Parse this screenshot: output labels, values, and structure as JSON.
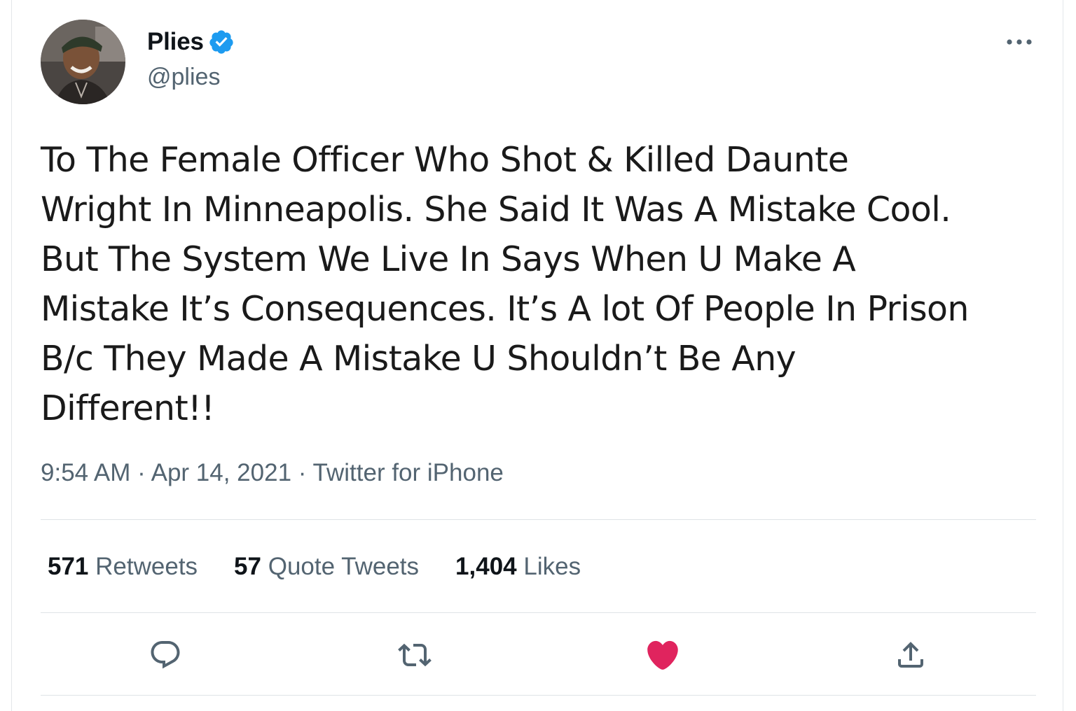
{
  "author": {
    "display_name": "Plies",
    "handle": "@plies",
    "verified_icon": "verified-badge-icon",
    "verified_color": "#1d9bf0"
  },
  "tweet": {
    "lines": [
      "To The Female Officer Who Shot & Killed Daunte",
      "Wright In Minneapolis. She Said It Was A Mistake Cool.",
      "But The System We Live In Says When U Make A",
      "Mistake It’s Consequences. It’s A lot Of People In Prison",
      "B/c They Made A Mistake U Shouldn’t Be Any",
      "Different!!"
    ]
  },
  "meta": {
    "time": "9:54 AM",
    "sep1": " · ",
    "date": "Apr 14, 2021",
    "sep2": " · ",
    "source": "Twitter for iPhone"
  },
  "stats": {
    "retweets": {
      "count": "571",
      "label": "Retweets"
    },
    "quotes": {
      "count": "57",
      "label": "Quote Tweets"
    },
    "likes": {
      "count": "1,404",
      "label": "Likes"
    }
  },
  "actions": {
    "reply_icon": "reply-icon",
    "retweet_icon": "retweet-icon",
    "like_icon": "heart-filled-icon",
    "share_icon": "share-icon",
    "like_color": "#e0245e",
    "icon_color": "#536471"
  }
}
